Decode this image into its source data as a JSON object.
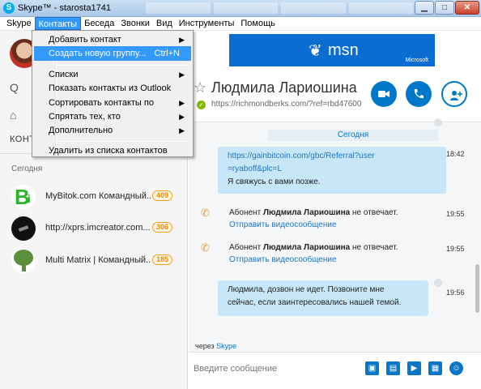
{
  "window": {
    "title": "Skype™ - starosta1741",
    "buttons": {
      "minimize": "▁",
      "maximize": "□",
      "close": "✕"
    }
  },
  "menu": {
    "items": [
      "Skype",
      "Контакты",
      "Беседа",
      "Звонки",
      "Вид",
      "Инструменты",
      "Помощь"
    ],
    "active": "Контакты"
  },
  "dropdown": {
    "items": [
      {
        "label": "Добавить контакт",
        "submenu": true
      },
      {
        "label": "Создать новую группу...",
        "shortcut": "Ctrl+N",
        "highlighted": true
      },
      {
        "label": "Списки",
        "submenu": true
      },
      {
        "label": "Показать контакты из Outlook"
      },
      {
        "label": "Сортировать контакты по",
        "submenu": true
      },
      {
        "label": "Спрятать тех, кто",
        "submenu": true
      },
      {
        "label": "Дополнительно",
        "submenu": true
      },
      {
        "label": "Удалить из списка контактов"
      }
    ]
  },
  "sidebar": {
    "contacts_label": "КОНТ",
    "search_glyph": "Q",
    "home_glyph": "⌂",
    "today_label": "Сегодня",
    "recent": [
      {
        "name": "MyBitok.com Командный...",
        "badge": "409"
      },
      {
        "name": "http://xprs.imcreator.com...",
        "badge": "306"
      },
      {
        "name": "Multi Matrix | Командный...",
        "badge": "185"
      }
    ]
  },
  "ad": {
    "brand": "msn",
    "company": "Microsoft"
  },
  "contact": {
    "name": "Людмила Лариошина",
    "mood_link": "https://richmondberks.com/?ref=rbd47600"
  },
  "chat": {
    "day_separator": "Сегодня",
    "messages": [
      {
        "type": "bubble",
        "lines": [
          "https://gainbitcoin.com/gbc/Referral?user",
          "=ryaboff&plc=L"
        ],
        "text": "Я свяжусь с вами позже.",
        "time": "18:42"
      },
      {
        "type": "missed",
        "prefix": "Абонент",
        "name": "Людмила Лариошина",
        "suffix": "не отвечает.",
        "action": "Отправить видеосообщение",
        "time": "19:55"
      },
      {
        "type": "missed",
        "prefix": "Абонент",
        "name": "Людмила Лариошина",
        "suffix": "не отвечает.",
        "action": "Отправить видеосообщение",
        "time": "19:55"
      },
      {
        "type": "bubble",
        "lines": [
          "Людмила, дозвон не идет. Позвоните мне",
          "сейчас, если заинтересовались нашей темой."
        ],
        "time": "19:56"
      }
    ]
  },
  "compose": {
    "via_prefix": "через",
    "via_service": "Skype",
    "placeholder": "Введите сообщение"
  },
  "colors": {
    "accent": "#0078ca",
    "menu_highlight": "#3399ff",
    "bubble": "#c7e7f8",
    "badge": "#f29c1f"
  }
}
